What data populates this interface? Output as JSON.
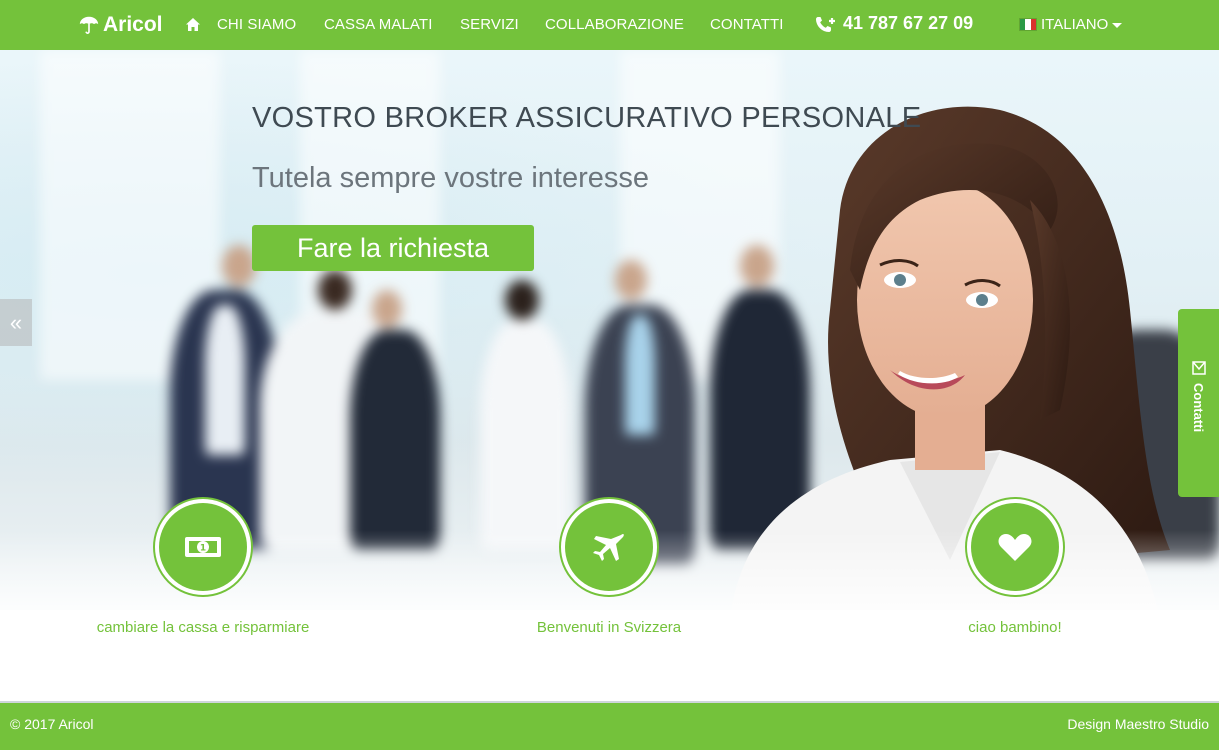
{
  "brand": {
    "name": "Aricol",
    "icon": "umbrella-icon"
  },
  "nav": {
    "home_icon": "home-icon",
    "items": [
      {
        "label": "CHI SIAMO"
      },
      {
        "label": "CASSA MALATI"
      },
      {
        "label": "SERVIZI"
      },
      {
        "label": "COLLABORAZIONE"
      },
      {
        "label": "CONTATTI"
      }
    ],
    "phone": "41 787 67 27 09",
    "phone_icon": "phone-icon",
    "language": "ITALIANO",
    "flag_icon": "italy-flag-icon"
  },
  "hero": {
    "title": "VOSTRO BROKER ASSICURATIVO PERSONALE",
    "subtitle": "Tutela sempre vostre interesse",
    "cta_label": "Fare la richiesta",
    "prev_label": "«"
  },
  "side_tab": {
    "label": "Contatti",
    "icon": "mail-icon"
  },
  "features": [
    {
      "icon": "money-icon",
      "caption": "cambiare la cassa e risparmiare"
    },
    {
      "icon": "plane-icon",
      "caption": "Benvenuti in Svizzera"
    },
    {
      "icon": "heart-icon",
      "caption": "ciao bambino!"
    }
  ],
  "footer": {
    "copyright": "© 2017 Aricol",
    "credit": "Design Maestro Studio"
  },
  "colors": {
    "accent": "#74c23b",
    "text_dark": "#3f4a52",
    "text_muted": "#6c757c"
  }
}
